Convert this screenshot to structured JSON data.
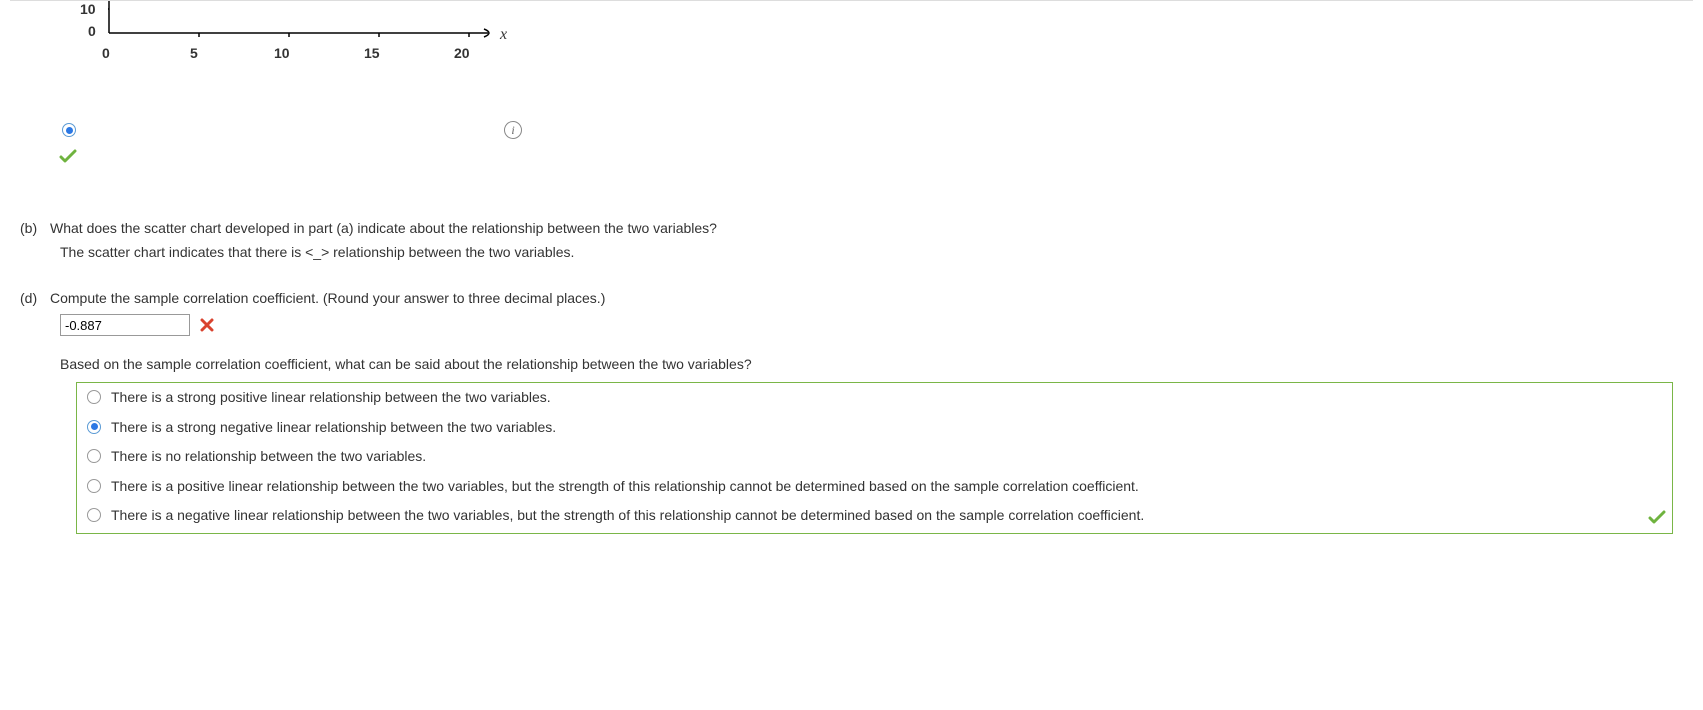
{
  "chart_data": {
    "type": "scatter",
    "x_ticks": [
      0,
      5,
      10,
      15,
      20
    ],
    "y_ticks_visible": [
      10,
      0
    ],
    "xlabel": "x",
    "xlim": [
      0,
      22
    ],
    "values": []
  },
  "axis": {
    "y10": "10",
    "y0": "0",
    "x0": "0",
    "x5": "5",
    "x10": "10",
    "x15": "15",
    "x20": "20",
    "xvar": "x"
  },
  "info_glyph": "i",
  "part_b": {
    "label": "(b)",
    "question": "What does the scatter chart developed in part (a) indicate about the relationship between the two variables?",
    "answer_template": "The scatter chart indicates that there is <_> relationship between the two variables."
  },
  "part_d": {
    "label": "(d)",
    "question": "Compute the sample correlation coefficient. (Round your answer to three decimal places.)",
    "input_value": "-0.887",
    "sub_question": "Based on the sample correlation coefficient, what can be said about the relationship between the two variables?",
    "options": [
      "There is a strong positive linear relationship between the two variables.",
      "There is a strong negative linear relationship between the two variables.",
      "There is no relationship between the two variables.",
      "There is a positive linear relationship between the two variables, but the strength of this relationship cannot be determined based on the sample correlation coefficient.",
      "There is a negative linear relationship between the two variables, but the strength of this relationship cannot be determined based on the sample correlation coefficient."
    ],
    "selected_index": 1
  }
}
